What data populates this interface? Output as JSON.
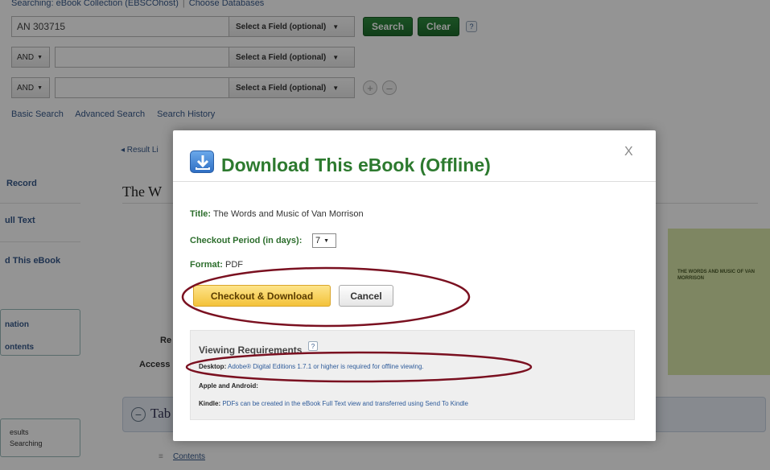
{
  "search": {
    "searching_label": "Searching: eBook Collection (EBSCOhost)",
    "choose_databases": "Choose Databases",
    "query": "AN 303715",
    "field_select_label": "Select a Field (optional)",
    "bool_label": "AND",
    "search_button": "Search",
    "clear_button": "Clear",
    "help": "?",
    "add": "+",
    "remove": "–",
    "links": [
      "Basic Search",
      "Advanced Search",
      "Search History"
    ]
  },
  "page": {
    "result_list_link": "◂ Result Li",
    "title_stub": "The W",
    "left_nav": [
      "Record",
      "ull Text",
      "d This eBook",
      "nation",
      "ontents",
      "esults",
      "Searching"
    ],
    "meta_labels": [
      "Re",
      "Access"
    ],
    "toc_tab": "Tab",
    "contents_link": "Contents",
    "cover_title": "THE WORDS AND MUSIC OF VAN MORRISON"
  },
  "modal": {
    "title": "Download This eBook (Offline)",
    "close": "X",
    "title_label": "Title:",
    "title_value": "The Words and Music of Van Morrison",
    "period_label": "Checkout Period (in days):",
    "period_value": "7",
    "format_label": "Format:",
    "format_value": "PDF",
    "checkout_button": "Checkout & Download",
    "cancel_button": "Cancel",
    "requirements": {
      "heading": "Viewing Requirements",
      "help": "?",
      "desktop_label": "Desktop:",
      "desktop_text": "Adobe® Digital Editions 1.7.1 or higher is required for offline viewing.",
      "apple_label": "Apple and Android:",
      "kindle_label": "Kindle:",
      "kindle_text": "PDFs can be created in the eBook Full Text view and transferred using Send To Kindle"
    }
  },
  "colors": {
    "title_green": "#2d7a2f",
    "button_green": "#2e8b3e",
    "checkout_yellow": "#f3c23a",
    "annotation_red": "#7a1020"
  }
}
